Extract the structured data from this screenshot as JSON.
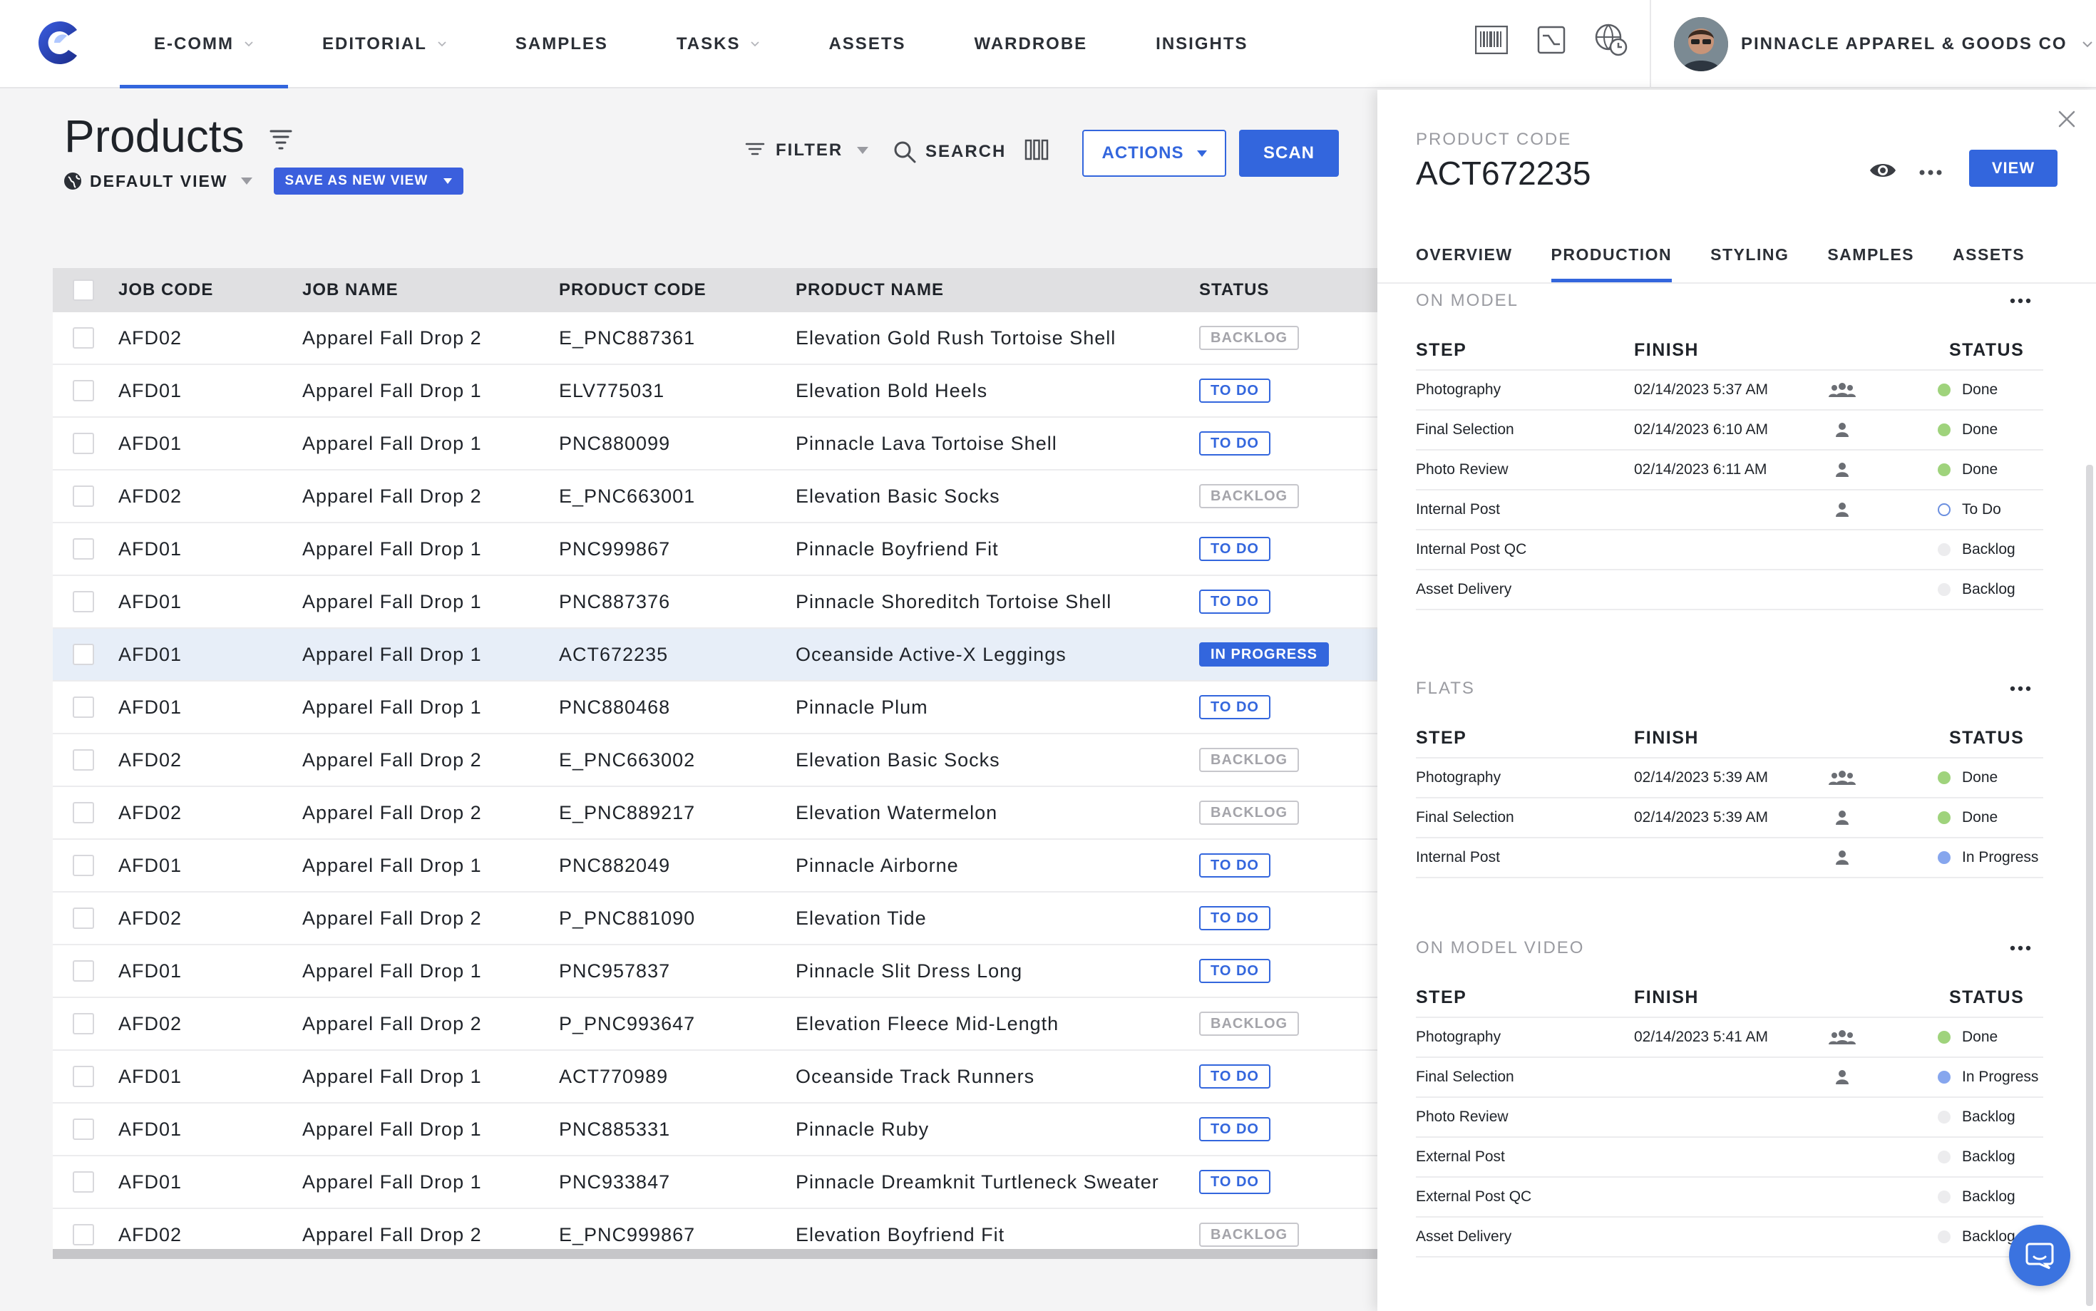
{
  "nav": {
    "items": [
      {
        "label": "E-COMM",
        "dropdown": true,
        "active": true
      },
      {
        "label": "EDITORIAL",
        "dropdown": true,
        "active": false
      },
      {
        "label": "SAMPLES",
        "dropdown": false,
        "active": false
      },
      {
        "label": "TASKS",
        "dropdown": true,
        "active": false
      },
      {
        "label": "ASSETS",
        "dropdown": false,
        "active": false
      },
      {
        "label": "WARDROBE",
        "dropdown": false,
        "active": false
      },
      {
        "label": "INSIGHTS",
        "dropdown": false,
        "active": false
      }
    ],
    "tools": [
      "barcode-icon",
      "activity-chart-icon",
      "global-time-icon"
    ],
    "account": "PINNACLE APPAREL & GOODS CO"
  },
  "header": {
    "title": "Products",
    "view_label": "DEFAULT VIEW",
    "save_view_label": "SAVE AS NEW VIEW",
    "filter_label": "FILTER",
    "search_label": "SEARCH",
    "actions_label": "ACTIONS",
    "scan_label": "SCAN"
  },
  "table": {
    "columns": [
      "JOB CODE",
      "JOB NAME",
      "PRODUCT CODE",
      "PRODUCT NAME",
      "STATUS"
    ],
    "rows": [
      {
        "job": "AFD02",
        "job_name": "Apparel Fall Drop 2",
        "product_code": "E_PNC887361",
        "product_name": "Elevation Gold Rush Tortoise Shell",
        "status": "BACKLOG"
      },
      {
        "job": "AFD01",
        "job_name": "Apparel Fall Drop 1",
        "product_code": "ELV775031",
        "product_name": "Elevation Bold Heels",
        "status": "TO DO"
      },
      {
        "job": "AFD01",
        "job_name": "Apparel Fall Drop 1",
        "product_code": "PNC880099",
        "product_name": "Pinnacle Lava Tortoise Shell",
        "status": "TO DO"
      },
      {
        "job": "AFD02",
        "job_name": "Apparel Fall Drop 2",
        "product_code": "E_PNC663001",
        "product_name": "Elevation Basic Socks",
        "status": "BACKLOG"
      },
      {
        "job": "AFD01",
        "job_name": "Apparel Fall Drop 1",
        "product_code": "PNC999867",
        "product_name": "Pinnacle Boyfriend Fit",
        "status": "TO DO"
      },
      {
        "job": "AFD01",
        "job_name": "Apparel Fall Drop 1",
        "product_code": "PNC887376",
        "product_name": "Pinnacle Shoreditch Tortoise Shell",
        "status": "TO DO"
      },
      {
        "job": "AFD01",
        "job_name": "Apparel Fall Drop 1",
        "product_code": "ACT672235",
        "product_name": "Oceanside Active-X Leggings",
        "status": "IN PROGRESS",
        "selected": true
      },
      {
        "job": "AFD01",
        "job_name": "Apparel Fall Drop 1",
        "product_code": "PNC880468",
        "product_name": "Pinnacle Plum",
        "status": "TO DO"
      },
      {
        "job": "AFD02",
        "job_name": "Apparel Fall Drop 2",
        "product_code": "E_PNC663002",
        "product_name": "Elevation Basic Socks",
        "status": "BACKLOG"
      },
      {
        "job": "AFD02",
        "job_name": "Apparel Fall Drop 2",
        "product_code": "E_PNC889217",
        "product_name": "Elevation Watermelon",
        "status": "BACKLOG"
      },
      {
        "job": "AFD01",
        "job_name": "Apparel Fall Drop 1",
        "product_code": "PNC882049",
        "product_name": "Pinnacle Airborne",
        "status": "TO DO"
      },
      {
        "job": "AFD02",
        "job_name": "Apparel Fall Drop 2",
        "product_code": "P_PNC881090",
        "product_name": "Elevation Tide",
        "status": "TO DO"
      },
      {
        "job": "AFD01",
        "job_name": "Apparel Fall Drop 1",
        "product_code": "PNC957837",
        "product_name": "Pinnacle Slit Dress Long",
        "status": "TO DO"
      },
      {
        "job": "AFD02",
        "job_name": "Apparel Fall Drop 2",
        "product_code": "P_PNC993647",
        "product_name": "Elevation Fleece Mid-Length",
        "status": "BACKLOG"
      },
      {
        "job": "AFD01",
        "job_name": "Apparel Fall Drop 1",
        "product_code": "ACT770989",
        "product_name": "Oceanside Track Runners",
        "status": "TO DO"
      },
      {
        "job": "AFD01",
        "job_name": "Apparel Fall Drop 1",
        "product_code": "PNC885331",
        "product_name": "Pinnacle Ruby",
        "status": "TO DO"
      },
      {
        "job": "AFD01",
        "job_name": "Apparel Fall Drop 1",
        "product_code": "PNC933847",
        "product_name": "Pinnacle Dreamknit Turtleneck Sweater",
        "status": "TO DO"
      },
      {
        "job": "AFD02",
        "job_name": "Apparel Fall Drop 2",
        "product_code": "E_PNC999867",
        "product_name": "Elevation Boyfriend Fit",
        "status": "BACKLOG"
      }
    ]
  },
  "panel": {
    "code_label": "PRODUCT CODE",
    "code_value": "ACT672235",
    "view_label": "VIEW",
    "tabs": [
      {
        "label": "OVERVIEW",
        "active": false
      },
      {
        "label": "PRODUCTION",
        "active": true
      },
      {
        "label": "STYLING",
        "active": false
      },
      {
        "label": "SAMPLES",
        "active": false
      },
      {
        "label": "ASSETS",
        "active": false
      }
    ],
    "col_step": "STEP",
    "col_finish": "FINISH",
    "col_status": "STATUS",
    "sections": [
      {
        "title": "ON MODEL",
        "rows": [
          {
            "step": "Photography",
            "finish": "02/14/2023 5:37 AM",
            "assignee": "group",
            "status": "Done"
          },
          {
            "step": "Final Selection",
            "finish": "02/14/2023 6:10 AM",
            "assignee": "person",
            "status": "Done"
          },
          {
            "step": "Photo Review",
            "finish": "02/14/2023 6:11 AM",
            "assignee": "person",
            "status": "Done"
          },
          {
            "step": "Internal Post",
            "finish": "",
            "assignee": "person",
            "status": "To Do"
          },
          {
            "step": "Internal Post QC",
            "finish": "",
            "assignee": "",
            "status": "Backlog"
          },
          {
            "step": "Asset Delivery",
            "finish": "",
            "assignee": "",
            "status": "Backlog"
          }
        ]
      },
      {
        "title": "FLATS",
        "rows": [
          {
            "step": "Photography",
            "finish": "02/14/2023 5:39 AM",
            "assignee": "group",
            "status": "Done"
          },
          {
            "step": "Final Selection",
            "finish": "02/14/2023 5:39 AM",
            "assignee": "person",
            "status": "Done"
          },
          {
            "step": "Internal Post",
            "finish": "",
            "assignee": "person",
            "status": "In Progress"
          }
        ]
      },
      {
        "title": "ON MODEL VIDEO",
        "rows": [
          {
            "step": "Photography",
            "finish": "02/14/2023 5:41 AM",
            "assignee": "group",
            "status": "Done"
          },
          {
            "step": "Final Selection",
            "finish": "",
            "assignee": "person",
            "status": "In Progress"
          },
          {
            "step": "Photo Review",
            "finish": "",
            "assignee": "",
            "status": "Backlog"
          },
          {
            "step": "External Post",
            "finish": "",
            "assignee": "",
            "status": "Backlog"
          },
          {
            "step": "External Post QC",
            "finish": "",
            "assignee": "",
            "status": "Backlog"
          },
          {
            "step": "Asset Delivery",
            "finish": "",
            "assignee": "",
            "status": "Backlog"
          }
        ]
      }
    ]
  },
  "colors": {
    "accent": "#3366dd",
    "done": "#9fd37c",
    "in_progress": "#86a6ee",
    "backlog": "#ececee",
    "selected_row": "#e7eef8"
  }
}
